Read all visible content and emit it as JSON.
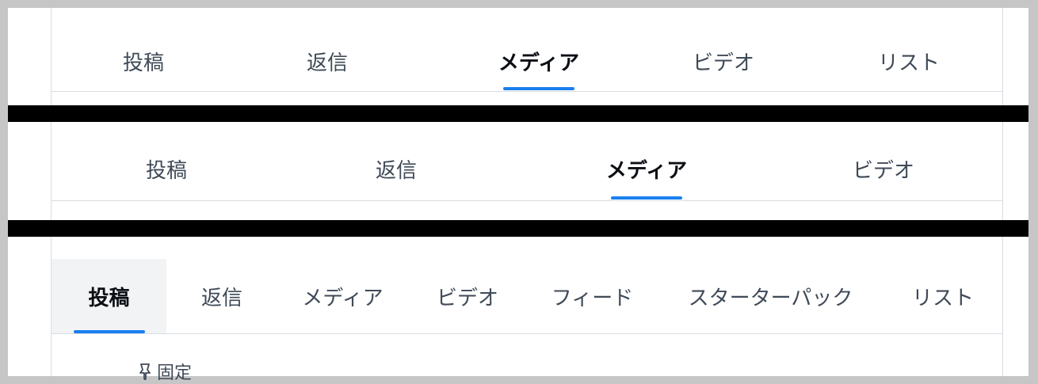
{
  "panel1": {
    "tabs": [
      {
        "label": "投稿"
      },
      {
        "label": "返信"
      },
      {
        "label": "メディア",
        "active": true
      },
      {
        "label": "ビデオ"
      },
      {
        "label": "リスト"
      }
    ]
  },
  "panel2": {
    "tabs": [
      {
        "label": "投稿"
      },
      {
        "label": "返信"
      },
      {
        "label": "メディア",
        "active": true
      },
      {
        "label": "ビデオ"
      }
    ]
  },
  "panel3": {
    "tabs": [
      {
        "label": "投稿",
        "active": true
      },
      {
        "label": "返信"
      },
      {
        "label": "メディア"
      },
      {
        "label": "ビデオ"
      },
      {
        "label": "フィード"
      },
      {
        "label": "スターターパック"
      },
      {
        "label": "リスト"
      }
    ],
    "pinned_label": "固定",
    "pinned_icon": "pin-icon"
  },
  "colors": {
    "accent": "#1a7ff0",
    "divider": "#000000",
    "tab_text": "#3f4a57",
    "active_tab_text": "#0b0f14",
    "active_tab_bg": "#f2f3f5",
    "border": "#d9dde2"
  }
}
